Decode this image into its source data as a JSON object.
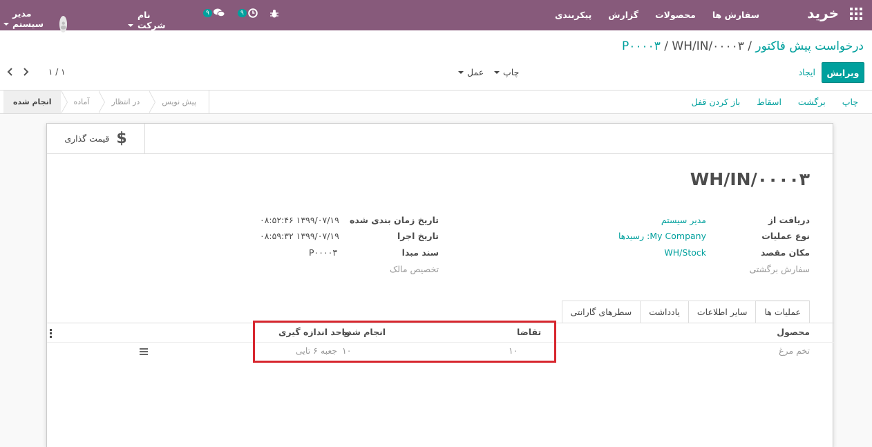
{
  "topbar": {
    "brand": "خرید",
    "menu": [
      "سفارش ها",
      "محصولات",
      "گزارش",
      "پیکربندی"
    ],
    "chat_count": "۹",
    "activity_count": "۹",
    "company": "نام شرکت شما",
    "user": "مدیر سیستم (demo)"
  },
  "breadcrumb": {
    "root": "درخواست پیش فاکتور",
    "parent": "P۰۰۰۰۳",
    "current": "WH/IN/۰۰۰۰۳",
    "sep": "/"
  },
  "buttons": {
    "edit": "ویرایش",
    "create": "ایجاد",
    "print": "چاپ",
    "action": "عمل"
  },
  "pager": {
    "value": "۱ / ۱"
  },
  "actions": [
    "چاپ",
    "برگشت",
    "اسقاط",
    "باز کردن قفل"
  ],
  "stages": [
    {
      "label": "انجام شده",
      "active": true
    },
    {
      "label": "آماده",
      "active": false
    },
    {
      "label": "در انتظار",
      "active": false
    },
    {
      "label": "پیش نویس",
      "active": false
    }
  ],
  "smart_button": {
    "label": "قیمت گذاری"
  },
  "record": {
    "title": "WH/IN/۰۰۰۰۳",
    "fields_right": [
      {
        "label": "دریافت از",
        "value": "مدیر سیستم"
      },
      {
        "label": "نوع عملیات",
        "value": "My Company: رسیدها"
      },
      {
        "label": "مکان مقصد",
        "value": "WH/Stock"
      },
      {
        "label": "سفارش برگشتی",
        "value": ""
      }
    ],
    "fields_left": [
      {
        "label": "تاریخ زمان بندی شده",
        "value": "۱۳۹۹/۰۷/۱۹ ۰۸:۵۲:۴۶"
      },
      {
        "label": "تاریخ اجرا",
        "value": "۱۳۹۹/۰۷/۱۹ ۰۸:۵۹:۳۲"
      },
      {
        "label": "سند مبدا",
        "value": "P۰۰۰۰۳"
      },
      {
        "label": "تخصیص مالک",
        "value": ""
      }
    ]
  },
  "tabs": [
    "عملیات ها",
    "سایر اطلاعات",
    "یادداشت",
    "سطرهای گارانتی"
  ],
  "table": {
    "headers": {
      "product": "محصول",
      "demand": "تقاضا",
      "done": "انجام شده",
      "uom": "واحد اندازه گیری"
    },
    "rows": [
      {
        "product": "تخم مرغ",
        "demand": "۱۰",
        "done": "۱۰",
        "uom": "جعبه ۶ تایی"
      }
    ]
  }
}
